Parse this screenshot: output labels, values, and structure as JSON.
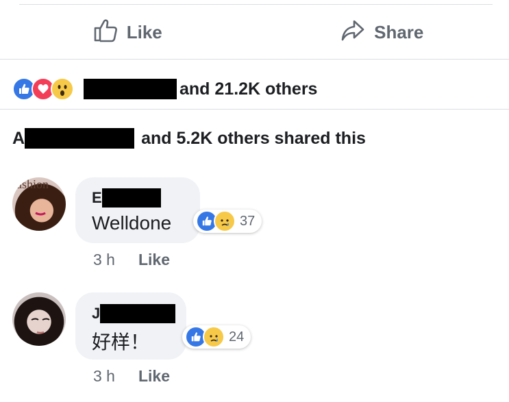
{
  "actions": {
    "like_label": "Like",
    "share_label": "Share"
  },
  "reactions_summary": {
    "icons": [
      "like-icon",
      "love-icon",
      "wow-icon"
    ],
    "text": "and 21.2K others"
  },
  "shares_summary": {
    "prefix": "A",
    "text": "and 5.2K others shared this"
  },
  "comments": [
    {
      "author_initial": "E",
      "text": "Welldone",
      "reactions": [
        "like-icon",
        "sad-icon"
      ],
      "reaction_count": "37",
      "time": "3 h",
      "like_label": "Like"
    },
    {
      "author_initial": "J",
      "text": "好样！",
      "reactions": [
        "like-icon",
        "sad-icon"
      ],
      "reaction_count": "24",
      "time": "3 h",
      "like_label": "Like"
    }
  ],
  "colors": {
    "like_blue": "#3578e5",
    "love_red": "#f33e58",
    "wow_yellow": "#f7c948",
    "meta_gray": "#606770",
    "bubble_gray": "#f0f2f5"
  }
}
